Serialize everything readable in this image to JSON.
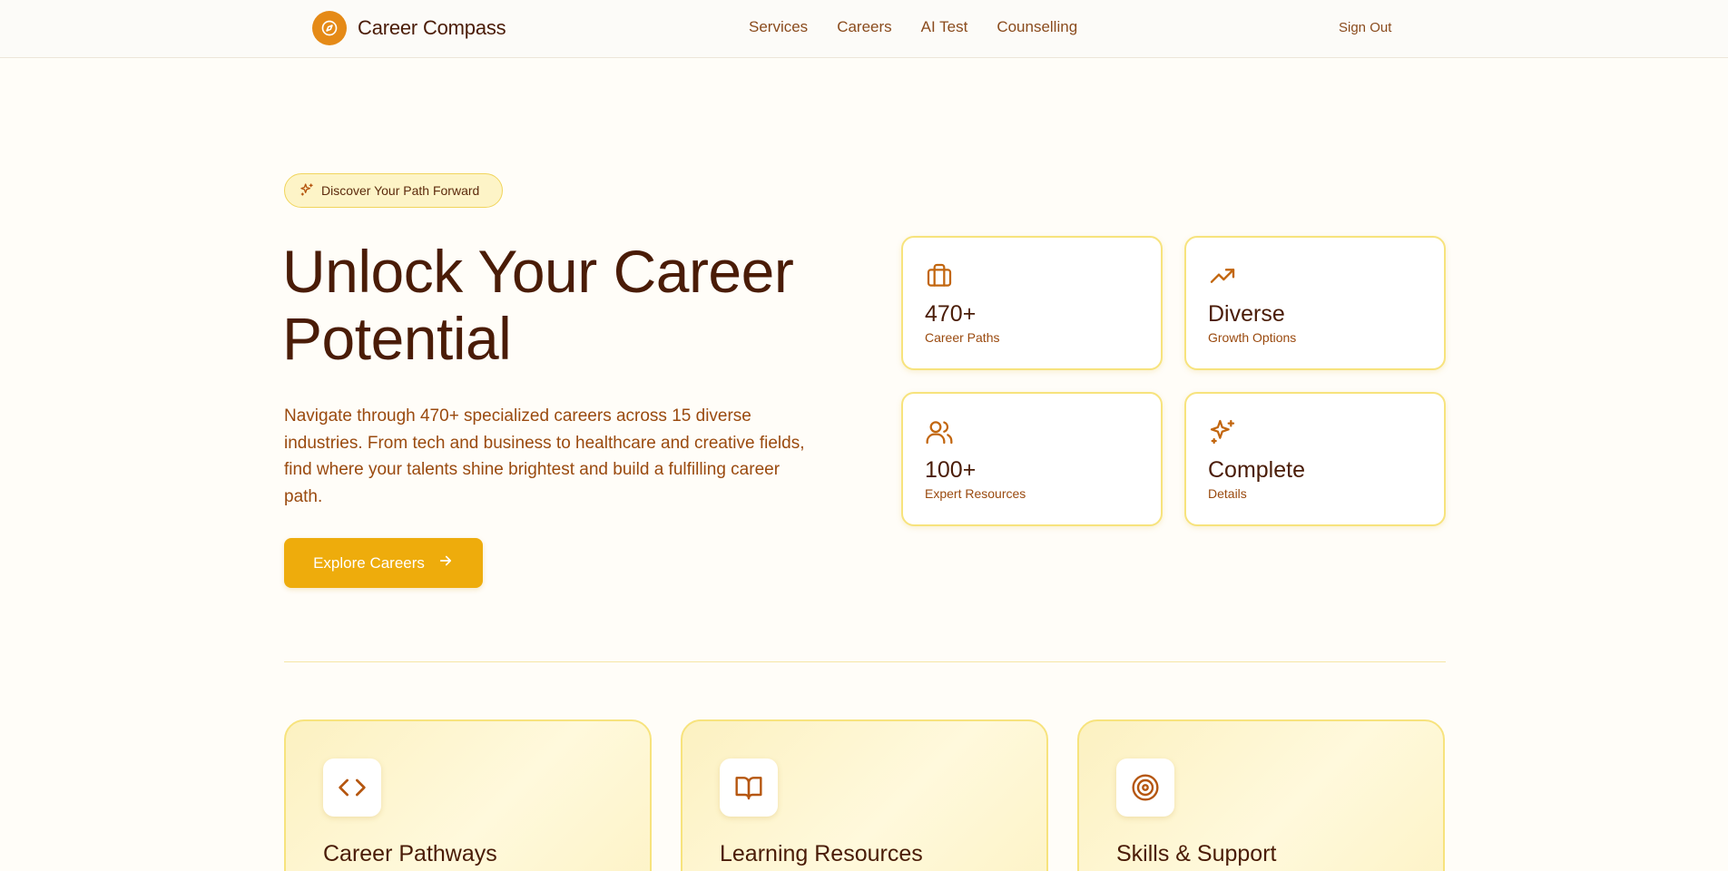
{
  "header": {
    "brand": "Career Compass",
    "nav": [
      "Services",
      "Careers",
      "AI Test",
      "Counselling"
    ],
    "sign_out": "Sign Out"
  },
  "hero": {
    "badge": "Discover Your Path Forward",
    "title": "Unlock Your Career Potential",
    "description": "Navigate through 470+ specialized careers across 15 diverse industries. From tech and business to healthcare and creative fields, find where your talents shine brightest and build a fulfilling career path.",
    "cta": "Explore Careers"
  },
  "stats": [
    {
      "icon": "briefcase-icon",
      "value": "470+",
      "label": "Career Paths"
    },
    {
      "icon": "trending-up-icon",
      "value": "Diverse",
      "label": "Growth Options"
    },
    {
      "icon": "users-icon",
      "value": "100+",
      "label": "Expert Resources"
    },
    {
      "icon": "sparkles-icon",
      "value": "Complete",
      "label": "Details"
    }
  ],
  "features": [
    {
      "icon": "code-icon",
      "title": "Career Pathways"
    },
    {
      "icon": "book-open-icon",
      "title": "Learning Resources"
    },
    {
      "icon": "target-icon",
      "title": "Skills & Support"
    }
  ],
  "colors": {
    "accent": "#e58a17",
    "cta": "#eeac0c",
    "text_dark": "#4a1c07",
    "text_brown": "#9a4a0f",
    "card_border": "#f7e37d"
  }
}
